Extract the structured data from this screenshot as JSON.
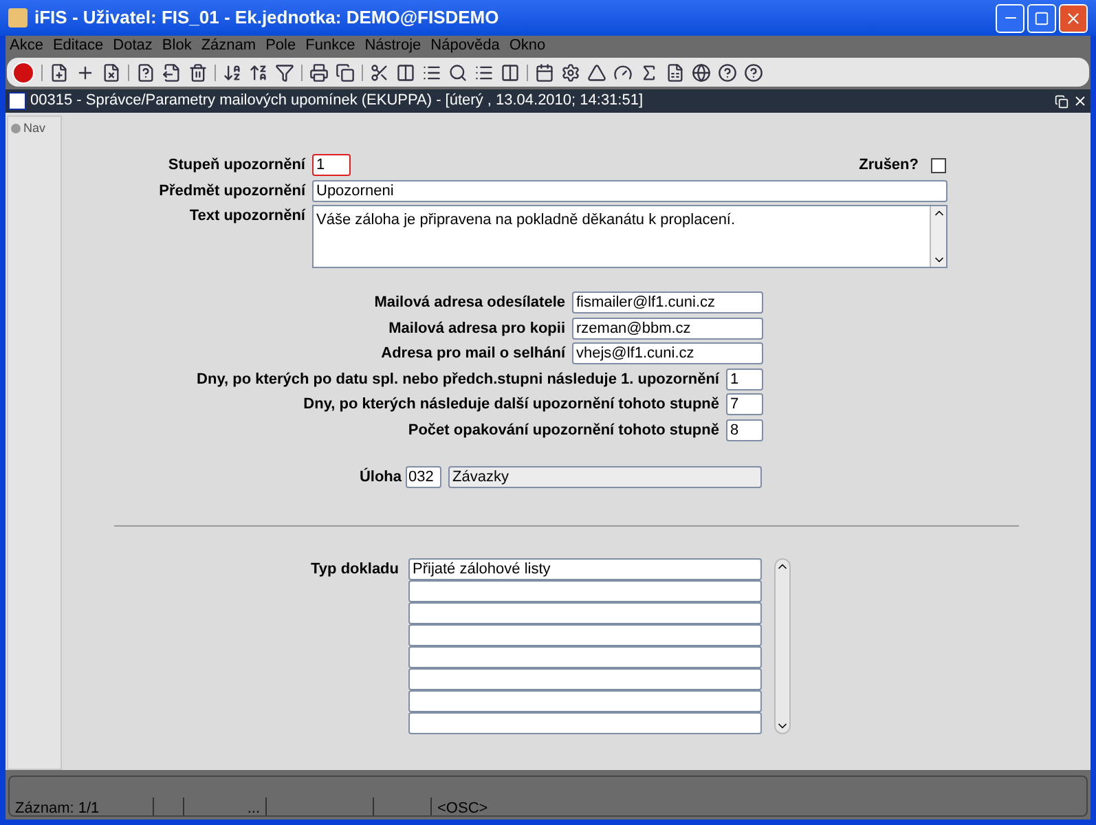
{
  "window": {
    "title": "iFIS - Uživatel: FIS_01 - Ek.jednotka: DEMO@FISDEMO"
  },
  "menu": [
    "Akce",
    "Editace",
    "Dotaz",
    "Blok",
    "Záznam",
    "Pole",
    "Funkce",
    "Nástroje",
    "Nápověda",
    "Okno"
  ],
  "form_window": {
    "title": "00315 - Správce/Parametry mailových upomínek (EKUPPA) - [úterý  , 13.04.2010; 14:31:51]"
  },
  "nav_tab": {
    "label": "Nav"
  },
  "header": {
    "level_label": "Stupeň upozornění",
    "level_value": "1",
    "cancelled_label": "Zrušen?",
    "cancelled_checked": false,
    "subject_label": "Předmět upozornění",
    "subject_value": "Upozorneni",
    "text_label": "Text upozornění",
    "text_value": "Váše záloha  je připravena na pokladně děkanátu k proplacení."
  },
  "settings": [
    {
      "kind": "wide",
      "label": "Mailová adresa odesílatele",
      "value": "fismailer@lf1.cuni.cz"
    },
    {
      "kind": "wide",
      "label": "Mailová adresa pro kopii",
      "value": "rzeman@bbm.cz"
    },
    {
      "kind": "wide",
      "label": "Adresa pro mail o selhání",
      "value": "vhejs@lf1.cuni.cz"
    },
    {
      "kind": "short",
      "label": "Dny, po kterých po datu spl. nebo předch.stupni následuje 1. upozornění",
      "value": "1"
    },
    {
      "kind": "short",
      "label": "Dny, po kterých následuje další upozornění tohoto stupně",
      "value": "7"
    },
    {
      "kind": "short",
      "label": "Počet opakování upozornění tohoto stupně",
      "value": "8"
    }
  ],
  "task": {
    "label": "Úloha",
    "code": "032",
    "name": "Závazky"
  },
  "document_types": {
    "label": "Typ dokladu",
    "rows": [
      "Přijaté zálohové listy",
      "",
      "",
      "",
      "",
      "",
      "",
      ""
    ]
  },
  "status_bar": [
    {
      "text": "Záznam: 1/1"
    },
    {
      "kind": "blank"
    },
    {
      "text": "..."
    },
    {
      "kind": "blank"
    },
    {
      "kind": "blank"
    },
    {
      "text": "<OSC>"
    }
  ]
}
